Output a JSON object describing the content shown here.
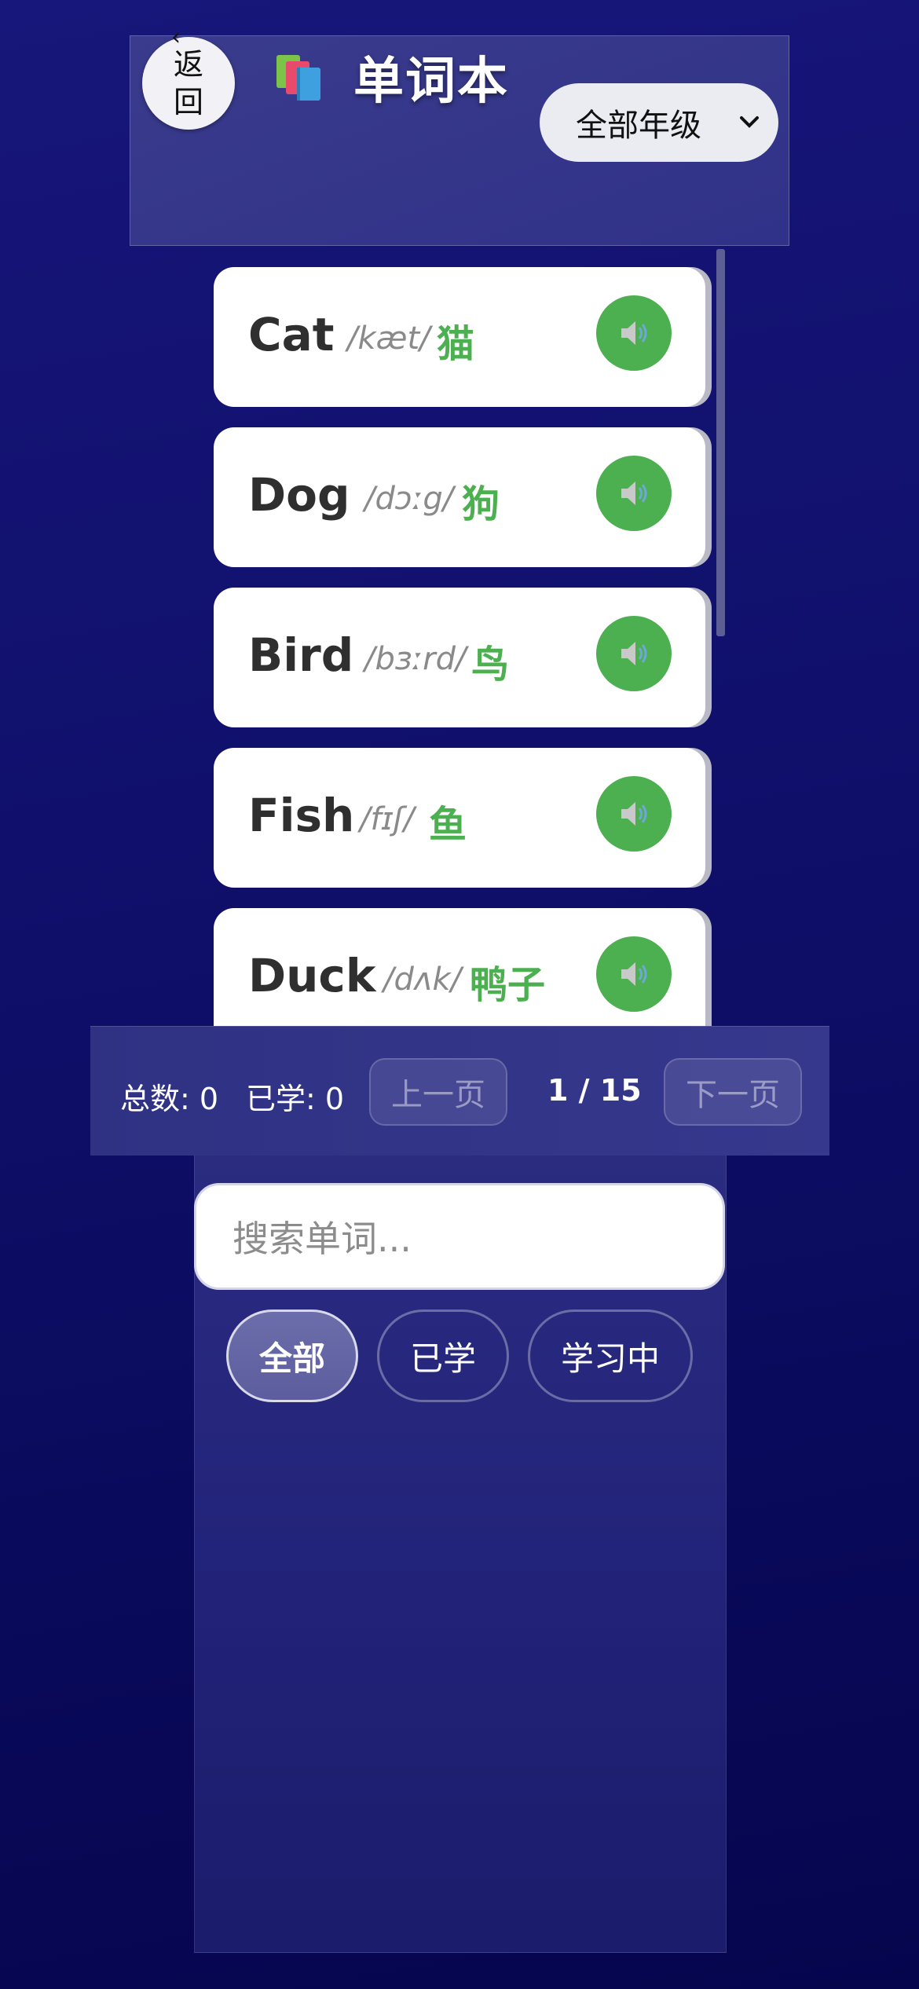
{
  "header": {
    "back_label": "返回",
    "back_icon": "arrow-left-icon",
    "title_icon": "books-icon",
    "title": "单词本",
    "grade_select": {
      "selected": "全部年级",
      "icon": "chevron-down-icon"
    }
  },
  "words": [
    {
      "en": "Cat",
      "ipa": "/kæt/",
      "cn": "猫"
    },
    {
      "en": "Dog",
      "ipa": "/dɔːg/",
      "cn": "狗"
    },
    {
      "en": "Bird",
      "ipa": "/bɜːrd/",
      "cn": "鸟"
    },
    {
      "en": "Fish",
      "ipa": "/fɪʃ/",
      "cn": "鱼"
    },
    {
      "en": "Duck",
      "ipa": "/dʌk/",
      "cn": "鸭子"
    }
  ],
  "pager": {
    "total": "总数: 0",
    "learned": "已学: 0",
    "prev": "上一页",
    "page": "1 / 15",
    "next": "下一页"
  },
  "search": {
    "placeholder": "搜索单词..."
  },
  "filters": [
    {
      "label": "全部",
      "active": true
    },
    {
      "label": "已学",
      "active": false
    },
    {
      "label": "学习中",
      "active": false
    }
  ],
  "colors": {
    "accent": "#4caf50",
    "background": "#13137a"
  }
}
